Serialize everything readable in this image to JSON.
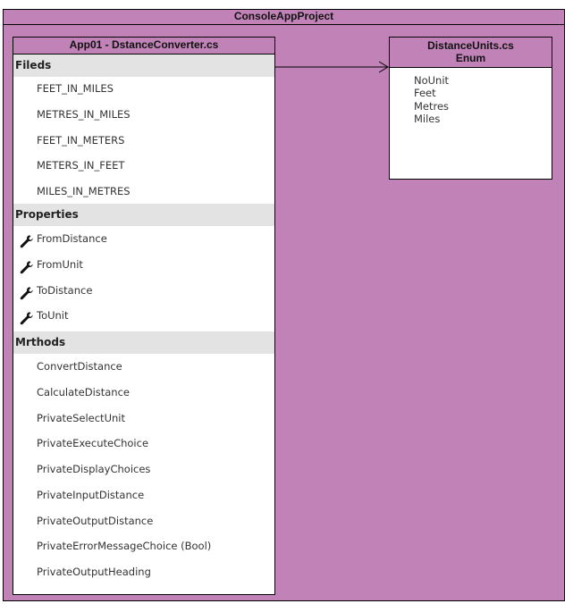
{
  "project": {
    "title": "ConsoleAppProject"
  },
  "class": {
    "title": "App01 - DstanceConverter.cs",
    "sections": {
      "fields": {
        "label": "Fileds",
        "items": [
          "FEET_IN_MILES",
          "METRES_IN_MILES",
          "FEET_IN_METERS",
          "METERS_IN_FEET",
          "MILES_IN_METRES"
        ]
      },
      "properties": {
        "label": "Properties",
        "items": [
          "FromDistance",
          "FromUnit",
          "ToDistance",
          "ToUnit"
        ]
      },
      "methods": {
        "label": "Mrthods",
        "items": [
          "ConvertDistance",
          "CalculateDistance",
          "PrivateSelectUnit",
          "PrivateExecuteChoice",
          "PrivateDisplayChoices",
          "PrivateInputDistance",
          "PrivateOutputDistance",
          "PrivateErrorMessageChoice (Bool)",
          "PrivateOutputHeading"
        ]
      }
    }
  },
  "enum": {
    "title_line1": "DistanceUnits.cs",
    "title_line2": "Enum",
    "items": [
      "NoUnit",
      "Feet",
      "Metres",
      "Miles"
    ]
  },
  "colors": {
    "container": "#c183b7",
    "section_header": "#e3e3e3"
  },
  "icons": {
    "property": "wrench-icon"
  }
}
